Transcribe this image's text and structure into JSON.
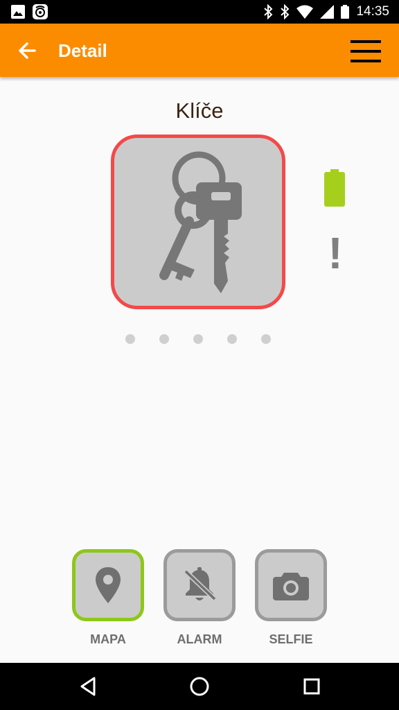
{
  "status_bar": {
    "time": "14:35",
    "icons": [
      "image-icon",
      "cast-app-icon",
      "bluetooth-icon",
      "bluetooth-icon",
      "wifi-icon",
      "signal-icon",
      "battery-icon"
    ]
  },
  "toolbar": {
    "title": "Detail",
    "back_icon": "arrow-left-icon",
    "menu_icon": "hamburger-menu-icon"
  },
  "item": {
    "name": "Klíče",
    "image_icon": "keys-icon",
    "border_color": "#f44949",
    "battery_color": "#a6cf1d",
    "alert_symbol": "!"
  },
  "pager": {
    "page_count": 5
  },
  "actions": [
    {
      "label": "MAPA",
      "icon": "map-pin-icon",
      "active": true
    },
    {
      "label": "ALARM",
      "icon": "bell-off-icon",
      "active": false
    },
    {
      "label": "SELFIE",
      "icon": "camera-icon",
      "active": false
    }
  ],
  "colors": {
    "accent": "#fb8c00",
    "active_border": "#8ec71a",
    "inactive_border": "#9b9b9b"
  },
  "nav_bar": {
    "icons": [
      "back-triangle-icon",
      "home-circle-icon",
      "recents-square-icon"
    ]
  }
}
